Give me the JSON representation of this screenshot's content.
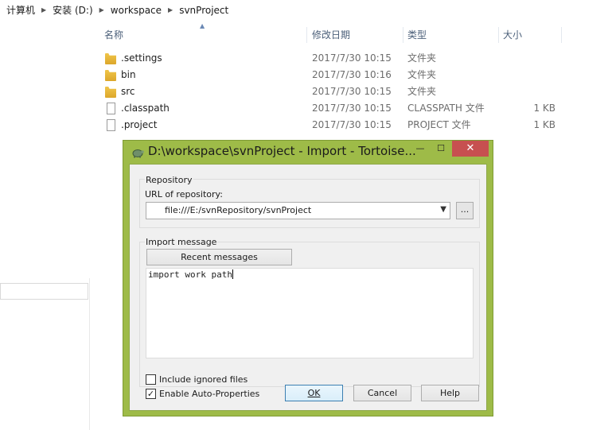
{
  "breadcrumb": [
    "计算机",
    "安装 (D:)",
    "workspace",
    "svnProject"
  ],
  "columns": {
    "name": "名称",
    "date": "修改日期",
    "type": "类型",
    "size": "大小"
  },
  "files": [
    {
      "name": ".settings",
      "date": "2017/7/30 10:15",
      "type": "文件夹",
      "size": "",
      "icon": "folder-icon"
    },
    {
      "name": "bin",
      "date": "2017/7/30 10:16",
      "type": "文件夹",
      "size": "",
      "icon": "folder-icon"
    },
    {
      "name": "src",
      "date": "2017/7/30 10:15",
      "type": "文件夹",
      "size": "",
      "icon": "folder-icon"
    },
    {
      "name": ".classpath",
      "date": "2017/7/30 10:15",
      "type": "CLASSPATH 文件",
      "size": "1 KB",
      "icon": "file-icon"
    },
    {
      "name": ".project",
      "date": "2017/7/30 10:15",
      "type": "PROJECT 文件",
      "size": "1 KB",
      "icon": "file-icon"
    }
  ],
  "dialog": {
    "title": "D:\\workspace\\svnProject - Import - Tortoise...",
    "minimize_glyph": "—",
    "maximize_glyph": "☐",
    "close_glyph": "✕",
    "repository_group": "Repository",
    "url_label": "URL of repository:",
    "url_value": "file:///E:/svnRepository/svnProject",
    "browse_label": "...",
    "import_group": "Import message",
    "recent_messages": "Recent messages",
    "message_text": "import work path",
    "include_ignored": "Include ignored files",
    "include_ignored_checked": false,
    "auto_props": "Enable Auto-Properties",
    "auto_props_checked": true,
    "ok": "OK",
    "cancel": "Cancel",
    "help": "Help"
  },
  "colors": {
    "dialog_frame": "#9ebb48",
    "close_button": "#c75050"
  }
}
